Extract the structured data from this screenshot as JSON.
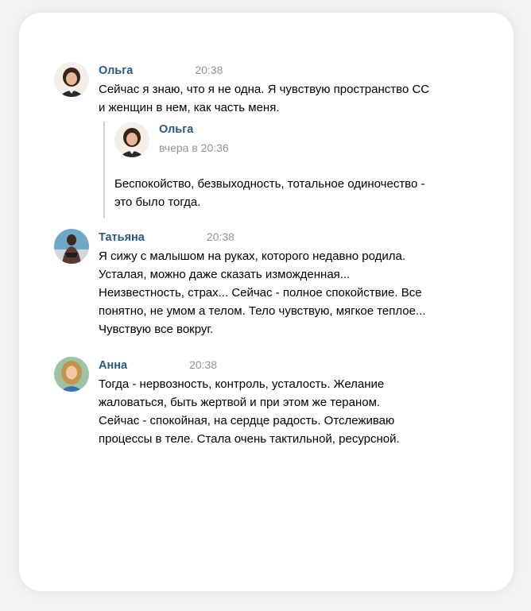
{
  "messages": [
    {
      "author": "Ольга",
      "time": "20:38",
      "lines": [
        "Сейчас я знаю, что я не одна. Я чувствую пространство СС",
        "и женщин в нем, как часть меня."
      ],
      "quoted": {
        "author": "Ольга",
        "time": "вчера в 20:36",
        "lines": [
          "Беспокойство, безвыходность, тотальное одиночество -",
          "это было тогда."
        ]
      }
    },
    {
      "author": "Татьяна",
      "time": "20:38",
      "lines": [
        "Я сижу с малышом на руках, которого недавно родила.",
        "Усталая, можно даже сказать изможденная...",
        "Неизвестность, страх... Сейчас - полное спокойствие. Все",
        "понятно, не умом а телом. Тело чувствую, мягкое теплое...",
        "Чувствую все вокруг."
      ]
    },
    {
      "author": "Анна",
      "time": "20:38",
      "lines": [
        "Тогда - нервозность, контроль, усталость. Желание",
        "жаловаться, быть жертвой и при этом же тераном.",
        "Сейчас - спокойная, на сердце радость. Отслеживаю",
        "процессы в теле. Стала очень тактильной, ресурсной."
      ]
    }
  ],
  "colors": {
    "author": "#2a5885",
    "time": "#939393",
    "text": "#000000",
    "quote_bar": "#c8d4e0"
  }
}
